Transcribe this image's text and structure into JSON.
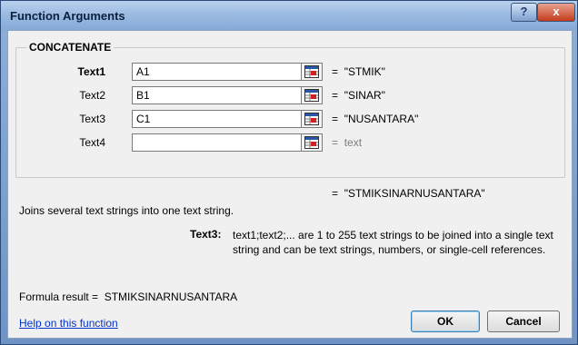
{
  "window": {
    "title": "Function Arguments",
    "help_glyph": "?",
    "close_glyph": "x"
  },
  "function": {
    "name": "CONCATENATE",
    "args": [
      {
        "label": "Text1",
        "value": "A1",
        "result": "\"STMIK\""
      },
      {
        "label": "Text2",
        "value": "B1",
        "result": "\"SINAR\""
      },
      {
        "label": "Text3",
        "value": "C1",
        "result": "\"NUSANTARA\""
      },
      {
        "label": "Text4",
        "value": "",
        "result": "text"
      }
    ],
    "equals": "=",
    "overall_result": "\"STMIKSINARNUSANTARA\"",
    "description": "Joins several text strings into one text string.",
    "arg_help_name": "Text3:",
    "arg_help_text": "text1;text2;... are 1 to 255 text strings to be joined into a single text string and can be text strings, numbers, or single-cell references."
  },
  "footer": {
    "formula_result_label": "Formula result =",
    "formula_result_value": "STMIKSINARNUSANTARA",
    "help_link": "Help on this function",
    "ok_label": "OK",
    "cancel_label": "Cancel"
  }
}
